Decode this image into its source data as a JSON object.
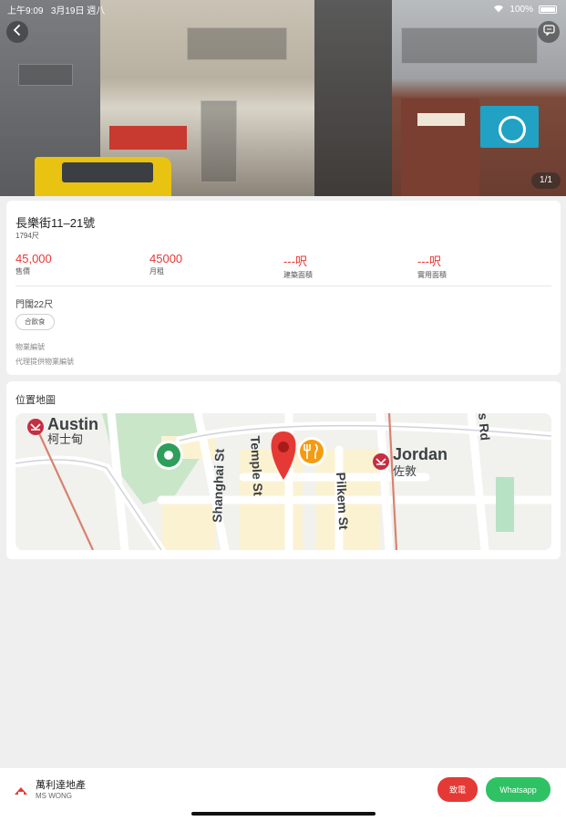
{
  "status_bar": {
    "time": "上午9:09",
    "date": "3月19日 週八",
    "battery": "100%"
  },
  "gallery": {
    "counter": "1/1"
  },
  "listing": {
    "title": "長樂街11–21號",
    "subtitle": "1794尺",
    "stats": [
      {
        "value": "45,000",
        "label": "售價"
      },
      {
        "value": "45000",
        "label": "月租"
      },
      {
        "value": "---呎",
        "label": "建築面積"
      },
      {
        "value": "---呎",
        "label": "實用面積"
      }
    ],
    "frontage": "門闊22尺",
    "tag": "合飲食",
    "ref_1": "物業編號",
    "ref_2": "代理提供物業編號"
  },
  "map_section": {
    "title": "位置地圖",
    "labels": {
      "austin_en": "Austin",
      "austin_zh": "柯士甸",
      "jordan_en": "Jordan",
      "jordan_zh": "佐敦",
      "shanghai_st": "Shanghai St",
      "temple_st": "Temple St",
      "pilkem_st": "Pilkem St",
      "road_partial": "s Rd"
    },
    "colors": {
      "pin": "#e53935",
      "restaurant": "#f39c12",
      "park_marker": "#2e9e5b",
      "mtr": "#c62e42"
    }
  },
  "bottom_bar": {
    "agency": "萬利達地產",
    "agent": "MS WONG",
    "call_label": "致電",
    "whatsapp_label": "Whatsapp"
  }
}
